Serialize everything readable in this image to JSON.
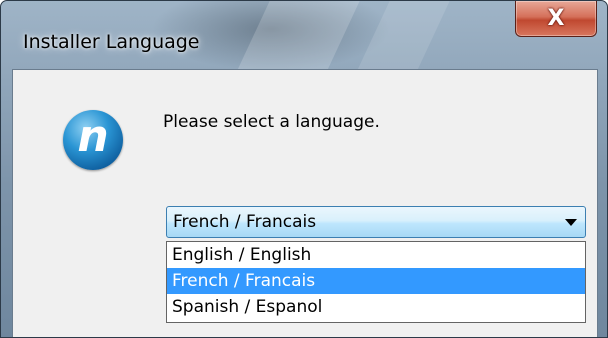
{
  "window": {
    "title": "Installer Language",
    "close_label": "X"
  },
  "icons": {
    "app_logo": "n-logo-icon",
    "app_logo_glyph": "n",
    "dropdown_arrow": "chevron-down-icon"
  },
  "dialog": {
    "prompt": "Please select a language.",
    "selected_value": "French / Francais",
    "options": [
      {
        "label": "English / English",
        "highlighted": false
      },
      {
        "label": "French / Francais",
        "highlighted": true
      },
      {
        "label": "Spanish / Espanol",
        "highlighted": false
      }
    ]
  },
  "colors": {
    "highlight": "#3399ff",
    "close_button": "#c04830",
    "logo_blue": "#1a7fc4"
  }
}
